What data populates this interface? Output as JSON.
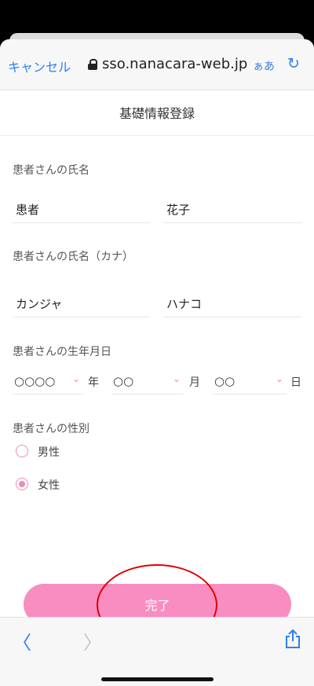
{
  "browser": {
    "cancel_label": "キャンセル",
    "url": "sso.nanacara-web.jp",
    "text_size_label": "ぁあ",
    "reload_icon": "reload-icon",
    "lock_icon": "lock-icon"
  },
  "page": {
    "title": "基礎情報登録"
  },
  "form": {
    "name_label": "患者さんの氏名",
    "last_name": "患者",
    "first_name": "花子",
    "kana_label": "患者さんの氏名（カナ）",
    "last_name_kana": "カンジャ",
    "first_name_kana": "ハナコ",
    "birthdate_label": "患者さんの生年月日",
    "birth_year": "○○○○",
    "year_unit": "年",
    "birth_month": "○○",
    "month_unit": "月",
    "birth_day": "○○",
    "day_unit": "日",
    "gender_label": "患者さんの性別",
    "gender_options": [
      "男性",
      "女性"
    ],
    "gender_selected": "女性"
  },
  "actions": {
    "submit_label": "完了"
  },
  "colors": {
    "accent": "#f98dc1",
    "ios_blue": "#2f80ed",
    "annotation_red": "#e00000"
  }
}
